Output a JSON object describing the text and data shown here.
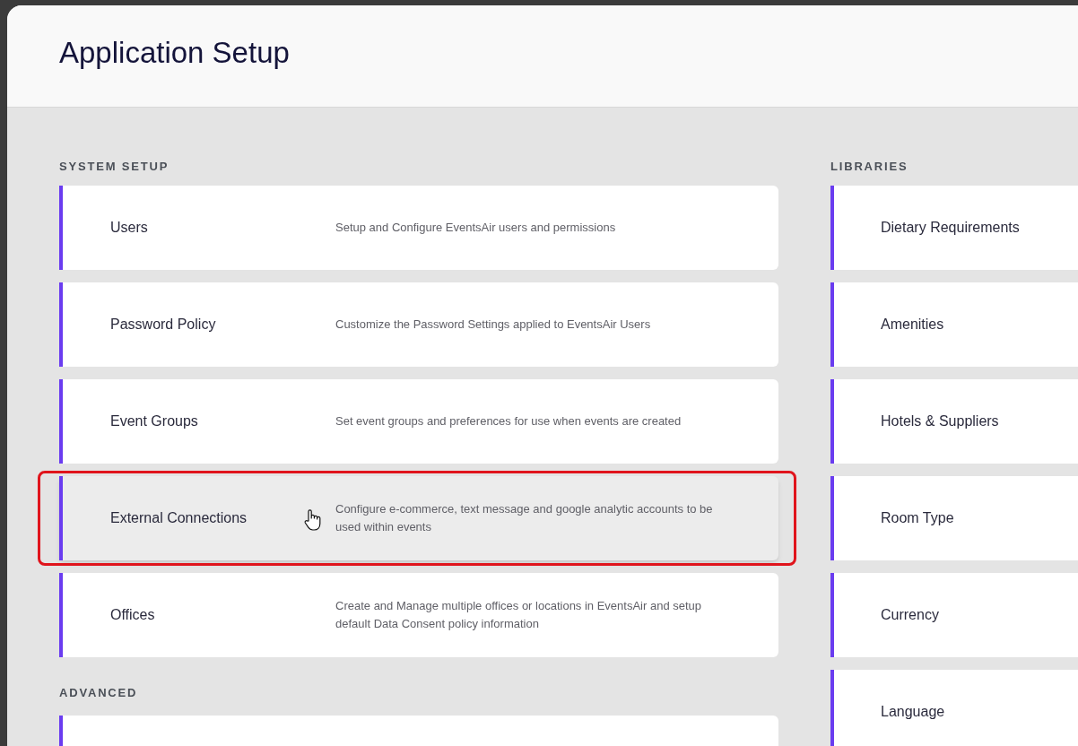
{
  "page": {
    "title": "Application Setup"
  },
  "system_setup": {
    "heading": "SYSTEM SETUP",
    "items": [
      {
        "label": "Users",
        "description": "Setup and Configure EventsAir users and permissions",
        "hovered": false,
        "highlighted": false
      },
      {
        "label": "Password Policy",
        "description": "Customize the Password Settings applied to EventsAir Users",
        "hovered": false,
        "highlighted": false
      },
      {
        "label": "Event Groups",
        "description": "Set event groups and preferences for use when events are created",
        "hovered": false,
        "highlighted": false
      },
      {
        "label": "External Connections",
        "description": "Configure e-commerce, text message and google analytic accounts to be used within events",
        "hovered": true,
        "highlighted": true
      },
      {
        "label": "Offices",
        "description": "Create and Manage multiple offices or locations in EventsAir and setup default Data Consent policy information",
        "hovered": false,
        "highlighted": false
      }
    ]
  },
  "advanced": {
    "heading": "ADVANCED"
  },
  "libraries": {
    "heading": "LIBRARIES",
    "items": [
      {
        "label": "Dietary Requirements"
      },
      {
        "label": "Amenities"
      },
      {
        "label": "Hotels & Suppliers"
      },
      {
        "label": "Room Type"
      },
      {
        "label": "Currency"
      },
      {
        "label": "Language"
      }
    ]
  }
}
